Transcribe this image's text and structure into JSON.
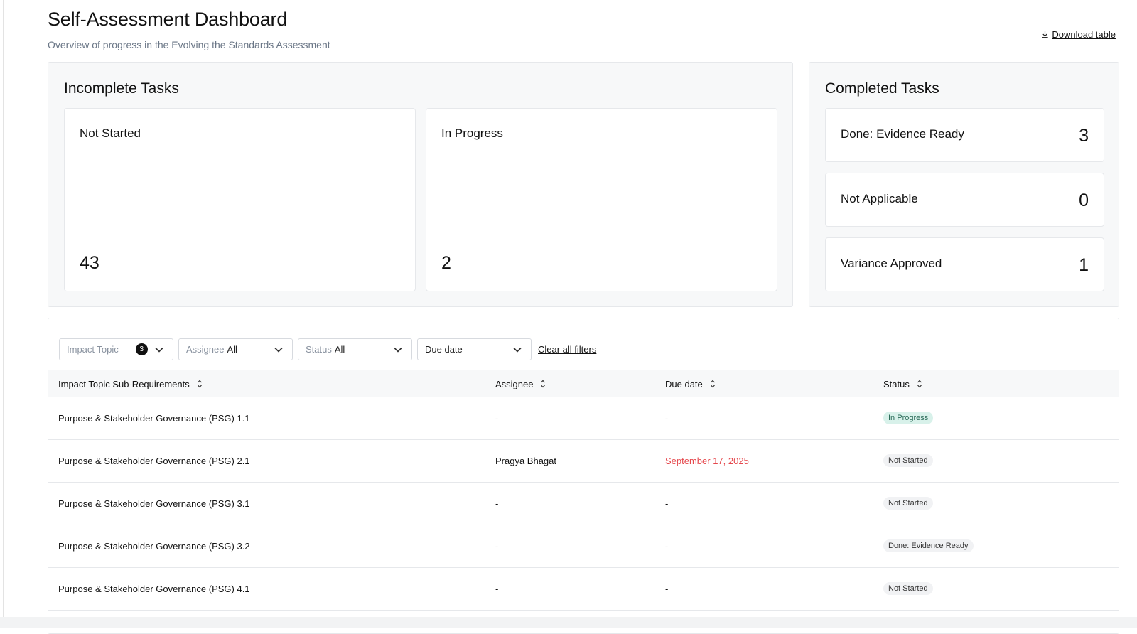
{
  "header": {
    "title": "Self-Assessment Dashboard",
    "subtitle": "Overview of progress in the Evolving the Standards Assessment",
    "download_label": "Download table"
  },
  "incomplete": {
    "title": "Incomplete Tasks",
    "cards": [
      {
        "label": "Not Started",
        "value": "43"
      },
      {
        "label": "In Progress",
        "value": "2"
      }
    ]
  },
  "completed": {
    "title": "Completed Tasks",
    "cards": [
      {
        "label": "Done: Evidence Ready",
        "value": "3"
      },
      {
        "label": "Not Applicable",
        "value": "0"
      },
      {
        "label": "Variance Approved",
        "value": "1"
      }
    ]
  },
  "filters": {
    "impact_topic": {
      "label": "Impact Topic",
      "count": "3"
    },
    "assignee": {
      "label": "Assignee",
      "value": "All"
    },
    "status": {
      "label": "Status",
      "value": "All"
    },
    "due_date": {
      "label": "Due date"
    },
    "clear_label": "Clear all filters"
  },
  "table": {
    "columns": [
      "Impact Topic Sub-Requirements",
      "Assignee",
      "Due date",
      "Status"
    ],
    "rows": [
      {
        "requirement": "Purpose & Stakeholder Governance (PSG) 1.1",
        "assignee": "-",
        "due": "-",
        "status": "In Progress"
      },
      {
        "requirement": "Purpose & Stakeholder Governance (PSG) 2.1",
        "assignee": "Pragya Bhagat",
        "due": "September 17, 2025",
        "status": "Not Started"
      },
      {
        "requirement": "Purpose & Stakeholder Governance (PSG) 3.1",
        "assignee": "-",
        "due": "-",
        "status": "Not Started"
      },
      {
        "requirement": "Purpose & Stakeholder Governance (PSG) 3.2",
        "assignee": "-",
        "due": "-",
        "status": "Done: Evidence Ready"
      },
      {
        "requirement": "Purpose & Stakeholder Governance (PSG) 4.1",
        "assignee": "-",
        "due": "-",
        "status": "Not Started"
      }
    ]
  },
  "colors": {
    "overdue_date": "#e5484d",
    "in_progress_pill_bg": "#d8f1ea",
    "in_progress_pill_text": "#2a6b58",
    "neutral_pill_bg": "#f1f2f4"
  },
  "icons": {
    "download": "download-icon",
    "chevron": "chevron-down-icon",
    "sort": "sort-icon"
  }
}
